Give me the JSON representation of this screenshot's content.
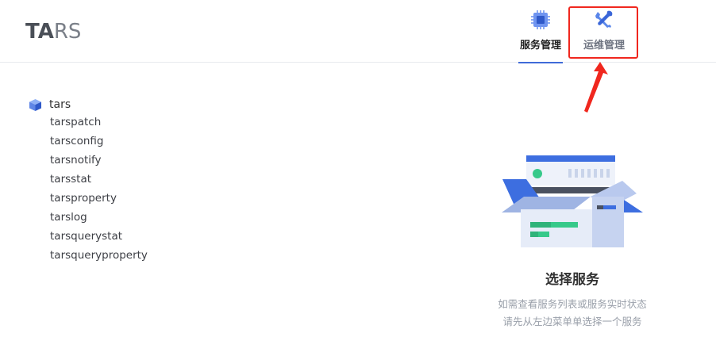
{
  "app": {
    "logo_bold": "TA",
    "logo_thin": "RS"
  },
  "nav": {
    "tabs": [
      {
        "label": "服务管理",
        "icon": "chip-icon",
        "active": true
      },
      {
        "label": "运维管理",
        "icon": "wrench-screwdriver-icon",
        "active": false
      }
    ]
  },
  "tree": {
    "root": {
      "label": "tars",
      "icon": "cube-icon"
    },
    "children": [
      "tarspatch",
      "tarsconfig",
      "tarsnotify",
      "tarsstat",
      "tarsproperty",
      "tarslog",
      "tarsquerystat",
      "tarsqueryproperty"
    ]
  },
  "empty_state": {
    "icon": "server-box-illustration",
    "title": "选择服务",
    "line1": "如需查看服务列表或服务实时状态",
    "line2": "请先从左边菜单单选择一个服务"
  },
  "colors": {
    "accent": "#3f6ad8",
    "highlight": "#f0271e",
    "active_text": "#222222",
    "muted_text": "#9aa0aa"
  }
}
